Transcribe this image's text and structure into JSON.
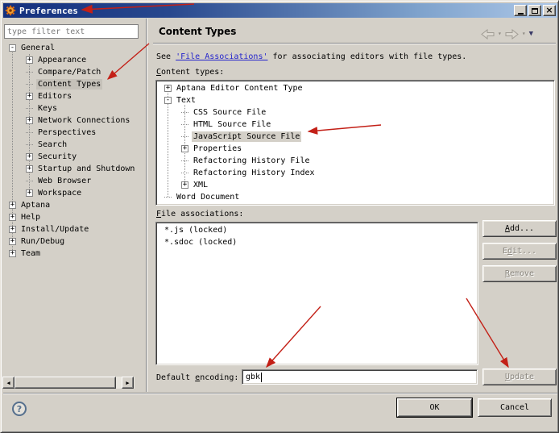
{
  "window": {
    "title": "Preferences"
  },
  "sidebar": {
    "filter_text": "type filter text",
    "tree": [
      {
        "label": "General",
        "level": 0,
        "box": "-",
        "selected": false
      },
      {
        "label": "Appearance",
        "level": 1,
        "box": "+",
        "selected": false
      },
      {
        "label": "Compare/Patch",
        "level": 1,
        "box": "",
        "selected": false
      },
      {
        "label": "Content Types",
        "level": 1,
        "box": "",
        "selected": true
      },
      {
        "label": "Editors",
        "level": 1,
        "box": "+",
        "selected": false
      },
      {
        "label": "Keys",
        "level": 1,
        "box": "",
        "selected": false
      },
      {
        "label": "Network Connections",
        "level": 1,
        "box": "+",
        "selected": false
      },
      {
        "label": "Perspectives",
        "level": 1,
        "box": "",
        "selected": false
      },
      {
        "label": "Search",
        "level": 1,
        "box": "",
        "selected": false
      },
      {
        "label": "Security",
        "level": 1,
        "box": "+",
        "selected": false
      },
      {
        "label": "Startup and Shutdown",
        "level": 1,
        "box": "+",
        "selected": false
      },
      {
        "label": "Web Browser",
        "level": 1,
        "box": "",
        "selected": false
      },
      {
        "label": "Workspace",
        "level": 1,
        "box": "+",
        "selected": false
      },
      {
        "label": "Aptana",
        "level": 0,
        "box": "+",
        "selected": false
      },
      {
        "label": "Help",
        "level": 0,
        "box": "+",
        "selected": false
      },
      {
        "label": "Install/Update",
        "level": 0,
        "box": "+",
        "selected": false
      },
      {
        "label": "Run/Debug",
        "level": 0,
        "box": "+",
        "selected": false
      },
      {
        "label": "Team",
        "level": 0,
        "box": "+",
        "selected": false
      }
    ]
  },
  "main": {
    "header": "Content Types",
    "assoc_note": {
      "pre": "See ",
      "link": "'File Associations'",
      "post": " for associating editors with file types."
    },
    "content_types_label": {
      "u": "C",
      "rest": "ontent types:"
    },
    "tree": [
      {
        "label": "Aptana Editor Content Type",
        "level": 0,
        "box": "+",
        "selected": false
      },
      {
        "label": "Text",
        "level": 0,
        "box": "-",
        "selected": false
      },
      {
        "label": "CSS Source File",
        "level": 1,
        "box": "",
        "selected": false
      },
      {
        "label": "HTML Source File",
        "level": 1,
        "box": "",
        "selected": false
      },
      {
        "label": "JavaScript Source File",
        "level": 1,
        "box": "",
        "selected": true
      },
      {
        "label": "Properties",
        "level": 1,
        "box": "+",
        "selected": false
      },
      {
        "label": "Refactoring History File",
        "level": 1,
        "box": "",
        "selected": false
      },
      {
        "label": "Refactoring History Index",
        "level": 1,
        "box": "",
        "selected": false
      },
      {
        "label": "XML",
        "level": 1,
        "box": "+",
        "selected": false
      },
      {
        "label": "Word Document",
        "level": 0,
        "box": "",
        "selected": false
      }
    ],
    "file_assoc_label": {
      "u": "F",
      "rest": "ile associations:"
    },
    "file_associations": [
      {
        "label": "*.js (locked)"
      },
      {
        "label": "*.sdoc (locked)"
      }
    ],
    "buttons": {
      "add": {
        "pre": "",
        "u": "A",
        "rest": "dd..."
      },
      "edit": {
        "pre": "E",
        "u": "d",
        "rest": "it..."
      },
      "remove": {
        "pre": "",
        "u": "R",
        "rest": "emove"
      },
      "update": {
        "pre": "",
        "u": "U",
        "rest": "pdate"
      }
    },
    "encoding": {
      "label_pre": "Default ",
      "label_u": "e",
      "label_rest": "ncoding:",
      "value": "gbk"
    }
  },
  "footer": {
    "help": "?",
    "ok": "OK",
    "cancel": "Cancel"
  },
  "colors": {
    "dialog_bg": "#d4d0c8",
    "titlebar_start": "#14307e",
    "titlebar_end": "#aec8e8",
    "link": "#2424cc",
    "annotation_arrow": "#c32017",
    "selection_gray": "#c5c1b9",
    "selection_white": "#d4d0c8"
  }
}
